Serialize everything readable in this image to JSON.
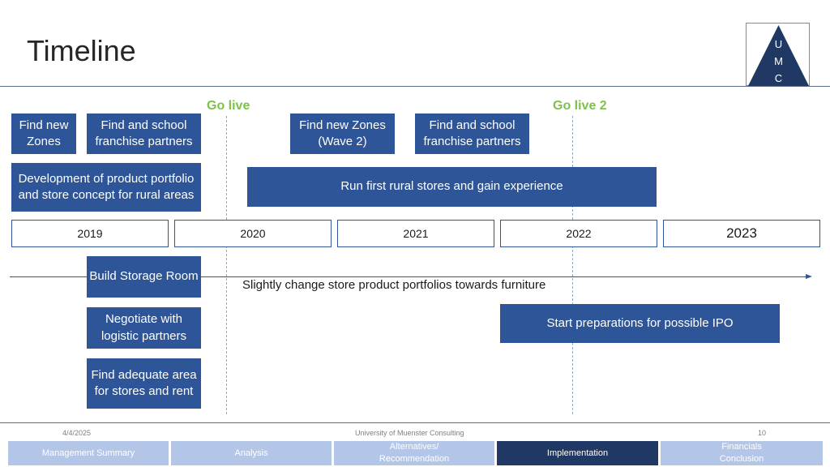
{
  "title": "Timeline",
  "logo": {
    "letters": [
      "U",
      "M",
      "C"
    ]
  },
  "milestones": {
    "go_live": "Go live",
    "go_live_2": "Go live 2"
  },
  "boxes": {
    "find_new_zones": "Find new Zones",
    "find_school_partners_1": "Find and school franchise partners",
    "find_new_zones_wave2": "Find new  Zones (Wave 2)",
    "find_school_partners_2": "Find and school franchise partners",
    "development_portfolio": "Development of product portfolio and store concept for rural areas",
    "run_rural_stores": "Run first rural stores and gain experience",
    "build_storage": "Build Storage Room",
    "negotiate_logistics": "Negotiate with logistic partners",
    "find_area": "Find adequate area for stores and rent",
    "start_ipo": "Start preparations for possible IPO"
  },
  "years": [
    "2019",
    "2020",
    "2021",
    "2022",
    "2023"
  ],
  "arrow_label": "Slightly change store product portfolios towards furniture",
  "footer": {
    "date": "4/4/2025",
    "company": "University of Muenster Consulting",
    "page": "10"
  },
  "nav": [
    {
      "label": "Management Summary",
      "active": false
    },
    {
      "label": "Analysis",
      "active": false
    },
    {
      "label": "Alternatives/ Recommendation",
      "active": false
    },
    {
      "label": "Implementation",
      "active": true
    },
    {
      "label": "Financials Conclusion",
      "active": false
    }
  ],
  "colors": {
    "box": "#2e5597",
    "go_live": "#7dc24a",
    "nav_inactive": "#b4c6e7",
    "nav_active": "#1f3864"
  }
}
